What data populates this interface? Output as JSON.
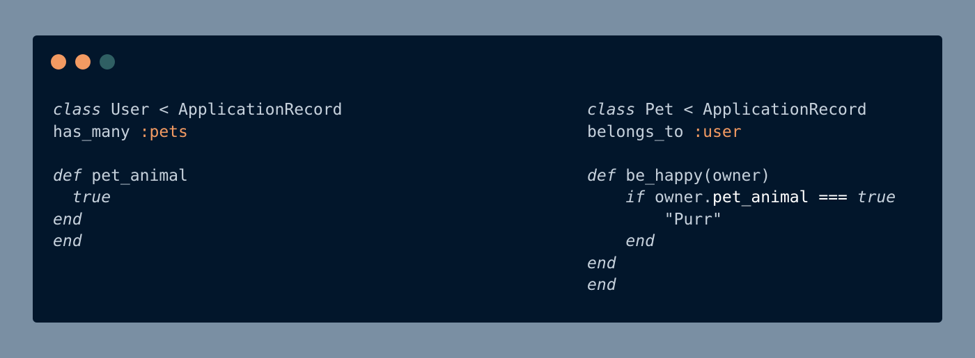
{
  "window": {
    "controls": [
      {
        "name": "close",
        "color": "#f29a62"
      },
      {
        "name": "minimize",
        "color": "#f29a62"
      },
      {
        "name": "maximize",
        "color": "#2f5f63"
      }
    ]
  },
  "colors": {
    "background": "#7a8fa3",
    "editor": "#02162b",
    "text": "#c6d1dc",
    "symbol": "#f29a62"
  },
  "code_left": {
    "l1_kw": "class",
    "l1_rest": " User < ApplicationRecord",
    "l2_method": "has_many ",
    "l2_symbol": ":pets",
    "l3": "",
    "l4_kw": "def",
    "l4_rest": " pet_animal",
    "l5_indent": "  ",
    "l5_kw": "true",
    "l6_kw": "end",
    "l7_kw": "end"
  },
  "code_right": {
    "l1_kw": "class",
    "l1_rest": " Pet < ApplicationRecord",
    "l2_method": "belongs_to ",
    "l2_symbol": ":user",
    "l3": "",
    "l4_kw": "def",
    "l4_rest": " be_happy(owner)",
    "l5_indent": "    ",
    "l5_kw": "if",
    "l5_owner": " owner.",
    "l5_method": "pet_animal ===",
    "l5_space": " ",
    "l5_true": "true",
    "l6_indent": "        ",
    "l6_str": "\"Purr\"",
    "l7_indent": "    ",
    "l7_kw": "end",
    "l8_kw": "end",
    "l9_kw": "end"
  }
}
